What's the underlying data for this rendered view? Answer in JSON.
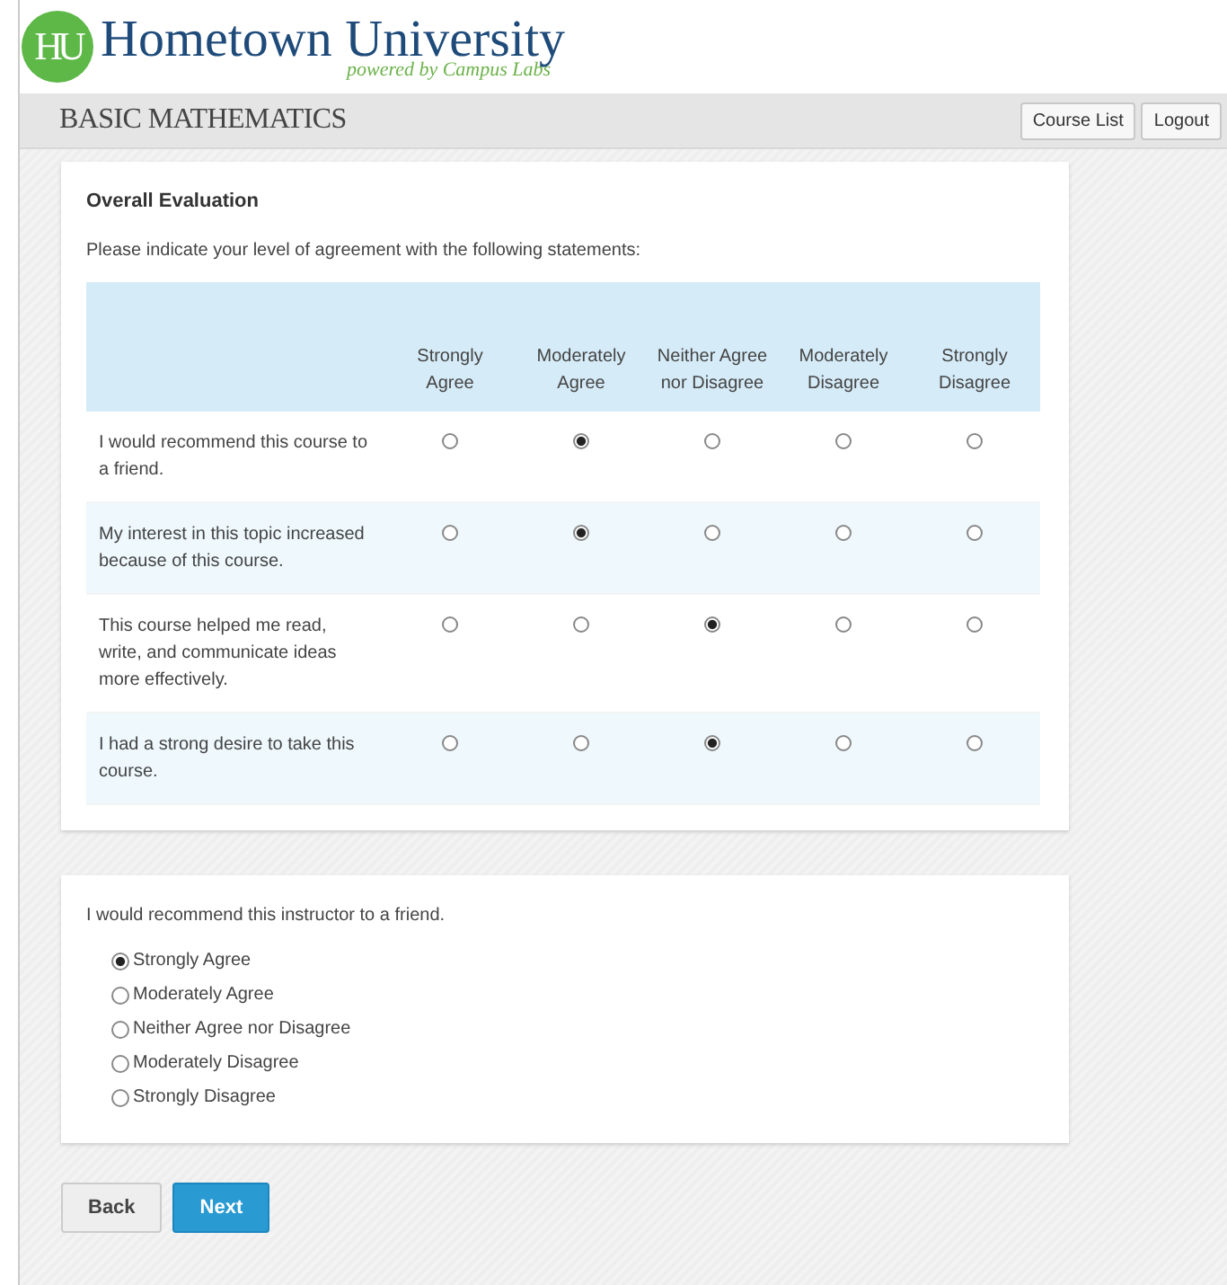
{
  "header": {
    "logo_mark": "HU",
    "university": "Hometown University",
    "powered_by": "powered by Campus Labs"
  },
  "title_bar": {
    "course": "BASIC MATHEMATICS",
    "buttons": [
      "Course List",
      "Logout"
    ]
  },
  "evaluation": {
    "title": "Overall Evaluation",
    "instructions": "Please indicate your level of agreement with the following statements:",
    "columns": [
      "Strongly Agree",
      "Moderately Agree",
      "Neither Agree nor Disagree",
      "Moderately Disagree",
      "Strongly Disagree"
    ],
    "rows": [
      {
        "statement": "I would recommend this course to a friend.",
        "choices": [
          {
            "selected": false
          },
          {
            "selected": true
          },
          {
            "selected": false
          },
          {
            "selected": false
          },
          {
            "selected": false
          }
        ]
      },
      {
        "statement": "My interest in this topic increased because of this course.",
        "choices": [
          {
            "selected": false
          },
          {
            "selected": true
          },
          {
            "selected": false
          },
          {
            "selected": false
          },
          {
            "selected": false
          }
        ]
      },
      {
        "statement": "This course helped me read, write, and communicate ideas more effectively.",
        "choices": [
          {
            "selected": false
          },
          {
            "selected": false
          },
          {
            "selected": true
          },
          {
            "selected": false
          },
          {
            "selected": false
          }
        ]
      },
      {
        "statement": "I had a strong desire to take this course.",
        "choices": [
          {
            "selected": false
          },
          {
            "selected": false
          },
          {
            "selected": true
          },
          {
            "selected": false
          },
          {
            "selected": false
          }
        ]
      }
    ]
  },
  "instructor_question": {
    "question": "I would recommend this instructor to a friend.",
    "options": [
      {
        "label": "Strongly Agree",
        "selected": true
      },
      {
        "label": "Moderately Agree",
        "selected": false
      },
      {
        "label": "Neither Agree nor Disagree",
        "selected": false
      },
      {
        "label": "Moderately Disagree",
        "selected": false
      },
      {
        "label": "Strongly Disagree",
        "selected": false
      }
    ]
  },
  "nav_buttons": [
    {
      "label": "Back",
      "kind": "secondary"
    },
    {
      "label": "Next",
      "kind": "primary"
    }
  ]
}
